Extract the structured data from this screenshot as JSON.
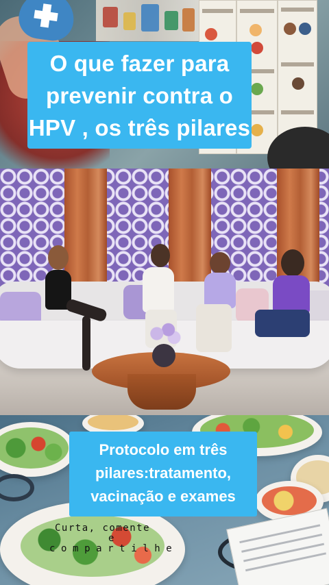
{
  "top_caption": {
    "line1": "O que fazer para",
    "line2": "prevenir contra o",
    "line3": "HPV , os três pilares"
  },
  "bottom_caption": {
    "line1": "Protocolo em três",
    "line2": "pilares:tratamento,",
    "line3": "vacinação e exames"
  },
  "watermark": {
    "line1": "Curta, comente",
    "line2": "e",
    "line3": "compartilhe"
  },
  "colors": {
    "caption_bg": "#3ab7f0",
    "caption_text": "#ffffff",
    "studio_wall": "#7e66b8",
    "curtain": "#c06a3c",
    "sofa": "#ecebeb"
  },
  "icons": {
    "medical_cross": "medical-cross-icon",
    "stethoscope": "stethoscope-icon"
  }
}
